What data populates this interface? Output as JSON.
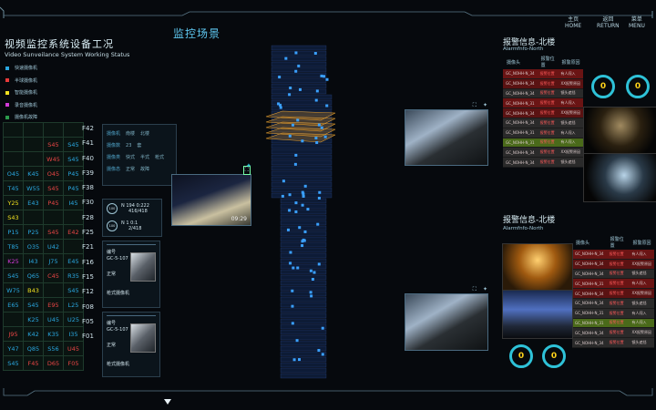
{
  "nav": {
    "home": {
      "cn": "主页",
      "en": "HOME"
    },
    "return": {
      "cn": "返回",
      "en": "RETURN"
    },
    "menu": {
      "cn": "菜单",
      "en": "MENU"
    }
  },
  "left": {
    "title_cn": "视频监控系统设备工况",
    "title_en": "Video Sunveilance System Working Status",
    "legend": [
      {
        "label": "快速摄像机",
        "color": "#2aa7e0"
      },
      {
        "label": "半球摄像机",
        "color": "#e83a3a"
      },
      {
        "label": "智能摄像机",
        "color": "#f0e020"
      },
      {
        "label": "录音摄像机",
        "color": "#d23ad8"
      },
      {
        "label": "摄像机故障",
        "color": "#2c9a4c"
      }
    ],
    "floors": [
      "F42",
      "F41",
      "F40",
      "F39",
      "F38",
      "F30",
      "F28",
      "F25",
      "F21",
      "F16",
      "F15",
      "F12",
      "F08",
      "F05",
      "F01"
    ],
    "grid_rows": [
      [
        {
          "t": "",
          "c": ""
        },
        {
          "t": "",
          "c": ""
        },
        {
          "t": "",
          "c": ""
        },
        {
          "t": "",
          "c": ""
        }
      ],
      [
        {
          "t": "",
          "c": ""
        },
        {
          "t": "",
          "c": ""
        },
        {
          "t": "S45",
          "c": "#e84545"
        },
        {
          "t": "S45",
          "c": "#2aa7e0"
        }
      ],
      [
        {
          "t": "",
          "c": ""
        },
        {
          "t": "",
          "c": ""
        },
        {
          "t": "W45",
          "c": "#e84545"
        },
        {
          "t": "S45",
          "c": "#2aa7e0"
        }
      ],
      [
        {
          "t": "O45",
          "c": "#2aa7e0"
        },
        {
          "t": "K45",
          "c": "#2aa7e0"
        },
        {
          "t": "O45",
          "c": "#e84545"
        },
        {
          "t": "P45",
          "c": "#2aa7e0"
        }
      ],
      [
        {
          "t": "T45",
          "c": "#2aa7e0"
        },
        {
          "t": "W55",
          "c": "#2aa7e0"
        },
        {
          "t": "S45",
          "c": "#e84545"
        },
        {
          "t": "P45",
          "c": "#2aa7e0"
        }
      ],
      [
        {
          "t": "Y25",
          "c": "#f0e020"
        },
        {
          "t": "E43",
          "c": "#2aa7e0"
        },
        {
          "t": "P45",
          "c": "#e84545"
        },
        {
          "t": "I45",
          "c": "#2aa7e0"
        }
      ],
      [
        {
          "t": "S43",
          "c": "#f0e020"
        },
        {
          "t": "",
          "c": ""
        },
        {
          "t": "",
          "c": ""
        },
        {
          "t": "",
          "c": ""
        }
      ],
      [
        {
          "t": "P15",
          "c": "#2aa7e0"
        },
        {
          "t": "P25",
          "c": "#2aa7e0"
        },
        {
          "t": "S45",
          "c": "#e84545"
        },
        {
          "t": "E42",
          "c": "#e84545"
        }
      ],
      [
        {
          "t": "T85",
          "c": "#2aa7e0"
        },
        {
          "t": "O35",
          "c": "#2aa7e0"
        },
        {
          "t": "U42",
          "c": "#2aa7e0"
        },
        {
          "t": "",
          "c": ""
        }
      ],
      [
        {
          "t": "K25",
          "c": "#d23ad8"
        },
        {
          "t": "I43",
          "c": "#2aa7e0"
        },
        {
          "t": "J75",
          "c": "#2aa7e0"
        },
        {
          "t": "E45",
          "c": "#2aa7e0"
        }
      ],
      [
        {
          "t": "S45",
          "c": "#2aa7e0"
        },
        {
          "t": "Q65",
          "c": "#2aa7e0"
        },
        {
          "t": "C45",
          "c": "#e84545"
        },
        {
          "t": "R35",
          "c": "#2aa7e0"
        }
      ],
      [
        {
          "t": "W75",
          "c": "#2aa7e0"
        },
        {
          "t": "B43",
          "c": "#f0e020"
        },
        {
          "t": "",
          "c": ""
        },
        {
          "t": "S45",
          "c": "#2aa7e0"
        }
      ],
      [
        {
          "t": "E65",
          "c": "#2aa7e0"
        },
        {
          "t": "S45",
          "c": "#2aa7e0"
        },
        {
          "t": "E95",
          "c": "#e84545"
        },
        {
          "t": "L25",
          "c": "#2aa7e0"
        }
      ],
      [
        {
          "t": "",
          "c": ""
        },
        {
          "t": "K25",
          "c": "#2aa7e0"
        },
        {
          "t": "U45",
          "c": "#2aa7e0"
        },
        {
          "t": "U25",
          "c": "#2aa7e0"
        }
      ],
      [
        {
          "t": "J95",
          "c": "#e84545"
        },
        {
          "t": "K42",
          "c": "#2aa7e0"
        },
        {
          "t": "K35",
          "c": "#2aa7e0"
        },
        {
          "t": "I35",
          "c": "#2aa7e0"
        }
      ],
      [
        {
          "t": "Y47",
          "c": "#2aa7e0"
        },
        {
          "t": "Q85",
          "c": "#2aa7e0"
        },
        {
          "t": "S56",
          "c": "#2aa7e0"
        },
        {
          "t": "U45",
          "c": "#e84545"
        }
      ],
      [
        {
          "t": "S45",
          "c": "#2aa7e0"
        },
        {
          "t": "F45",
          "c": "#e84545"
        },
        {
          "t": "D65",
          "c": "#e84545"
        },
        {
          "t": "F05",
          "c": "#e84545"
        }
      ]
    ]
  },
  "info": {
    "rows": [
      [
        "摄像机",
        "南楼",
        "北楼"
      ],
      [
        "摄像数",
        "23",
        "套"
      ],
      [
        "摄像类",
        "快式",
        "半式",
        "枪式"
      ],
      [
        "摄像态",
        "正常",
        "故障"
      ]
    ],
    "stats": [
      {
        "badge": "100",
        "l1": "N 194   0:222",
        "l2": "416/418"
      },
      {
        "badge": "100",
        "l1": "N 1   0:1",
        "l2": "2/418"
      }
    ],
    "cams": [
      {
        "title": "编号",
        "id": "GC-5-107",
        "status": "正常",
        "type": "枪式摄像机"
      },
      {
        "title": "编号",
        "id": "GC-5-107",
        "status": "正常",
        "type": "枪式摄像机"
      }
    ],
    "video_time": "09:29"
  },
  "center": {
    "title": "监控场景"
  },
  "alarms": [
    {
      "title": "报警信息-北楼",
      "sub": "Alarmfnfo-North",
      "headers": [
        "摄像头",
        "报警位置",
        "报警原因"
      ],
      "rows": [
        [
          "GC_NOHH-N_34",
          "报警位置",
          "有人闯入"
        ],
        [
          "GC_NOHH-N_34",
          "报警位置",
          "XX报警原因"
        ],
        [
          "GC_NOHH-N_34",
          "报警位置",
          "镜头遮挡"
        ],
        [
          "GC_NOHH-N_31",
          "报警位置",
          "有人闯入"
        ],
        [
          "GC_NOHH-N_34",
          "报警位置",
          "XX报警原因"
        ],
        [
          "GC_NOHH-N_34",
          "报警位置",
          "镜头遮挡"
        ],
        [
          "GC_NOHH-N_31",
          "报警位置",
          "有人闯入"
        ],
        [
          "GC_NOHH-N_31",
          "报警位置",
          "有人闯入"
        ],
        [
          "GC_NOHH-N_34",
          "报警位置",
          "XX报警原因"
        ],
        [
          "GC_NOHH-N_34",
          "报警位置",
          "镜头遮挡"
        ]
      ],
      "counters": [
        "0",
        "0"
      ]
    },
    {
      "title": "报警信息-北楼",
      "sub": "Alarmfnfo-North",
      "headers": [
        "摄像头",
        "报警位置",
        "报警原因"
      ],
      "rows": [
        [
          "GC_NOHH-N_34",
          "报警位置",
          "有人闯入"
        ],
        [
          "GC_NOHH-N_34",
          "报警位置",
          "XX报警原因"
        ],
        [
          "GC_NOHH-N_34",
          "报警位置",
          "镜头遮挡"
        ],
        [
          "GC_NOHH-N_31",
          "报警位置",
          "有人闯入"
        ],
        [
          "GC_NOHH-N_34",
          "报警位置",
          "XX报警原因"
        ],
        [
          "GC_NOHH-N_34",
          "报警位置",
          "镜头遮挡"
        ],
        [
          "GC_NOHH-N_31",
          "报警位置",
          "有人闯入"
        ],
        [
          "GC_NOHH-N_31",
          "报警位置",
          "有人闯入"
        ],
        [
          "GC_NOHH-N_34",
          "报警位置",
          "XX报警原因"
        ],
        [
          "GC_NOHH-N_34",
          "报警位置",
          "镜头遮挡"
        ]
      ],
      "counters": [
        "0",
        "0"
      ]
    }
  ],
  "colors": {
    "accent": "#5ec7f0",
    "alarm": "#ff5a5a",
    "counter": "#ffd21a",
    "ring": "#2ec2d8"
  }
}
